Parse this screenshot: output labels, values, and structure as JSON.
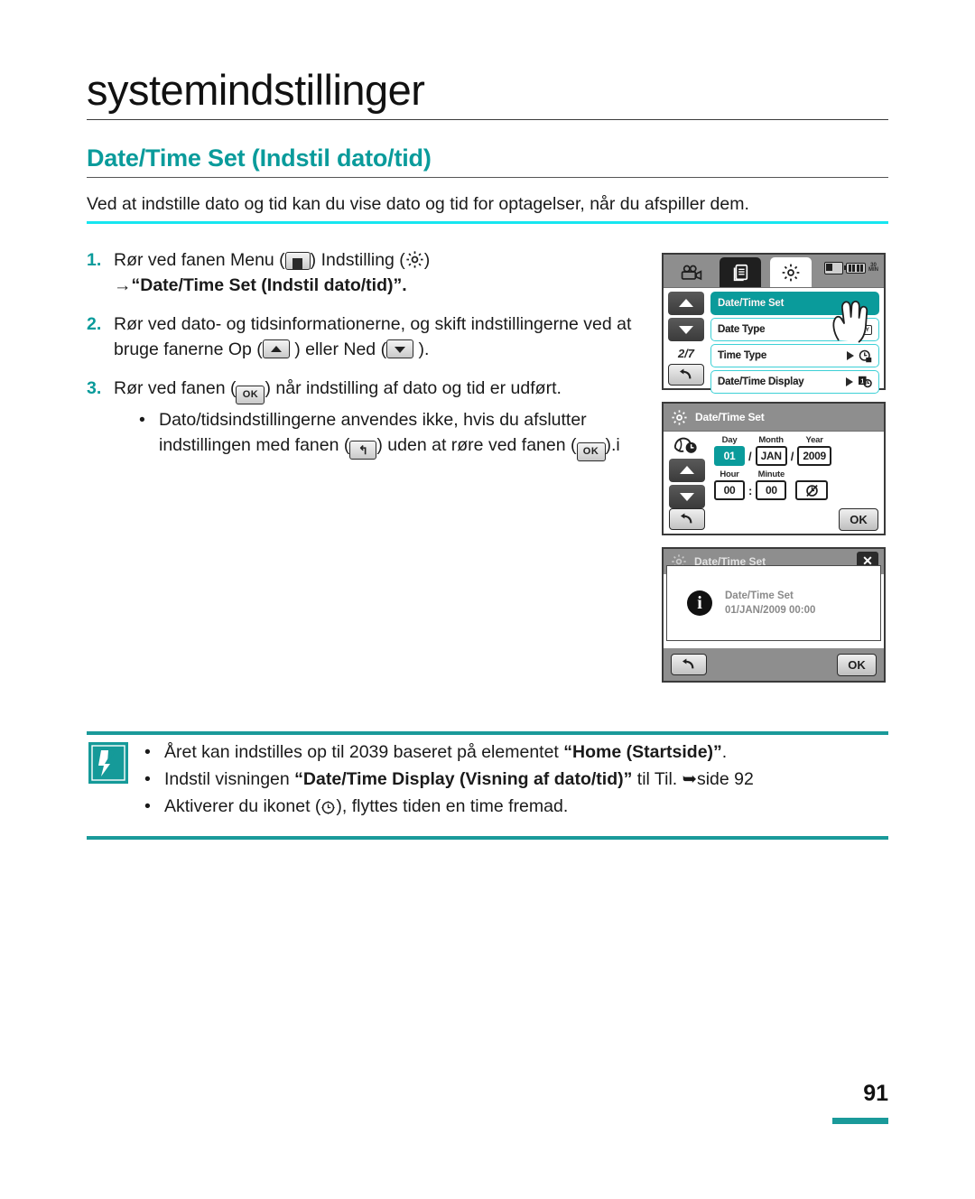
{
  "header": {
    "chapter_title": "systemindstillinger",
    "section_title": "Date/Time Set (Indstil dato/tid)",
    "intro": "Ved at indstille dato og tid kan du vise dato og tid for optagelser, når du afspiller dem."
  },
  "steps": [
    {
      "num": "1.",
      "text_a": "Rør ved fanen Menu (",
      "icon_a": "menu-icon",
      "text_b": ") Indstilling (",
      "icon_b": "gear-icon",
      "text_c": ")",
      "arrow": "→",
      "bold_line": "“Date/Time Set (Indstil dato/tid)”.",
      "text_d": ""
    },
    {
      "num": "2.",
      "text_a": "Rør ved dato- og tidsinformationerne, og skift indstillingerne ved at bruge fanerne Op (",
      "icon_a": "arrow-up-icon",
      "text_b": " ) eller Ned (",
      "icon_b": "arrow-down-icon",
      "text_c": " )."
    },
    {
      "num": "3.",
      "text_a": "Rør ved fanen (",
      "icon_a": "ok-icon",
      "text_b": ") når indstilling af dato og tid er udført.",
      "sub": {
        "dot": "•",
        "text_a": "Dato/tidsindstillingerne anvendes ikke, hvis du afslutter indstillingen med  fanen (",
        "icon_a": "back-icon",
        "text_b": ") uden at røre ved fanen (",
        "icon_b": "ok-icon",
        "text_c": ").i"
      }
    }
  ],
  "lcd1": {
    "tabs": [
      {
        "name": "camcorder-tab",
        "icon": "camcorder-icon",
        "active": false
      },
      {
        "name": "playback-tab",
        "icon": "pages-icon",
        "active": false
      },
      {
        "name": "settings-tab",
        "icon": "gear-icon",
        "active": true
      }
    ],
    "status": {
      "battery_icon": "battery-icon",
      "memory_icon": "battery-full-icon",
      "min_label": "30\nMIN"
    },
    "nav": {
      "up": "arrow-up-icon",
      "down": "arrow-down-icon",
      "page_indicator": "2/7",
      "back": "back-icon"
    },
    "menu_items": [
      {
        "label": "Date/Time Set",
        "selected": true,
        "value_icon": ""
      },
      {
        "label": "Date Type",
        "selected": false,
        "value_icon": "DMY"
      },
      {
        "label": "Time Type",
        "selected": false,
        "value_icon": "clock-24h-icon"
      },
      {
        "label": "Date/Time Display",
        "selected": false,
        "value_icon": "date-time-display-icon"
      }
    ],
    "cursor": "hand-pointer-icon"
  },
  "lcd2": {
    "title": "Date/Time Set",
    "title_icon": "gear-icon",
    "world_icon": "world-time-icon",
    "nav": {
      "up": "arrow-up-icon",
      "down": "arrow-down-icon"
    },
    "labels": {
      "day": "Day",
      "month": "Month",
      "year": "Year",
      "hour": "Hour",
      "minute": "Minute"
    },
    "values": {
      "day": "01",
      "month": "JAN",
      "year": "2009",
      "hour": "00",
      "minute": "00"
    },
    "separators": {
      "date": "/",
      "time": ":"
    },
    "dst_icon": "daylight-saving-icon",
    "back": "back-icon",
    "ok_label": "OK"
  },
  "lcd3": {
    "title": "Date/Time Set",
    "title_icon": "gear-icon",
    "close_icon": "close-icon",
    "info_icon": "info-icon",
    "message_line1": "Date/Time Set",
    "message_line2": "01/JAN/2009 00:00",
    "back": "back-icon",
    "ok_label": "OK"
  },
  "note": {
    "icon": "note-pen-icon",
    "items": [
      {
        "dot": "•",
        "text_a": "Året kan indstilles op til 2039 baseret på elementet ",
        "bold": "“Home (Startside)”",
        "text_b": "."
      },
      {
        "dot": "•",
        "text_a": "Indstil visningen ",
        "bold": "“Date/Time Display (Visning af dato/tid)”",
        "text_b": " til Til. ➥side 92"
      },
      {
        "dot": "•",
        "text_a": "Aktiverer du ikonet (",
        "icon": "clock-icon",
        "text_b": "), flyttes tiden en time fremad."
      }
    ]
  },
  "footer": {
    "page_number": "91"
  },
  "colors": {
    "teal": "#0a9b9b",
    "teal_bar": "#1a9a9a",
    "cyan_rule": "#16e6f0",
    "lcd_gray": "#8e8e8e"
  }
}
